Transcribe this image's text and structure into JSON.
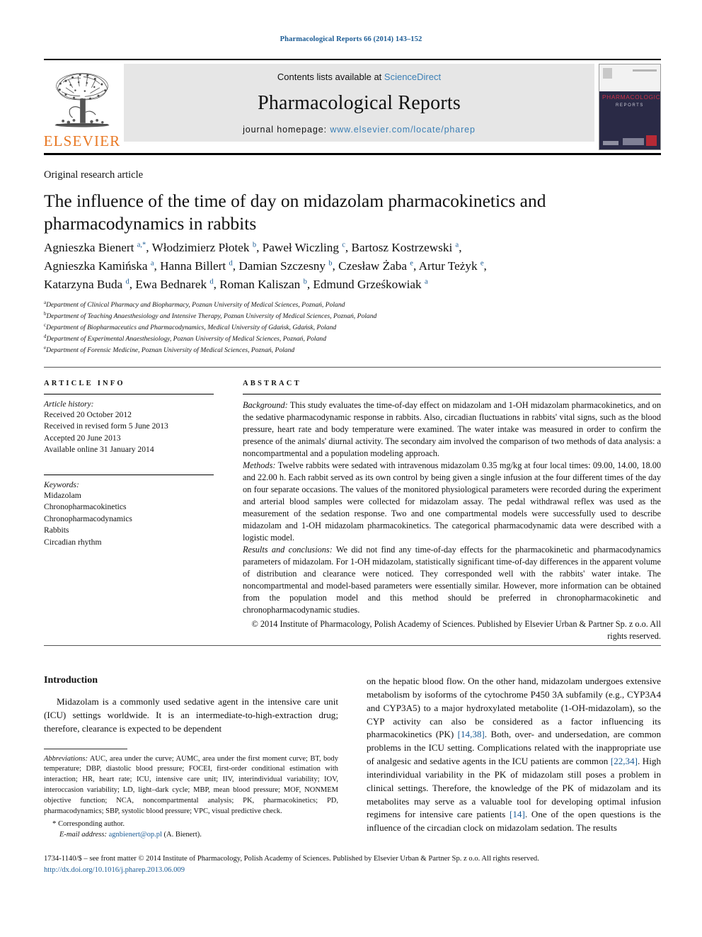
{
  "running_head": "Pharmacological Reports 66 (2014) 143–152",
  "masthead": {
    "contents_prefix": "Contents lists available at ",
    "sciencedirect": "ScienceDirect",
    "journal_name": "Pharmacological Reports",
    "homepage_prefix": "journal homepage: ",
    "homepage_url": "www.elsevier.com/locate/pharep",
    "publisher_logo_text": "ELSEVIER",
    "cover": {
      "title": "PHARMACOLOGICAL",
      "subtitle": "REPORTS"
    },
    "link_color": "#3b7fb5",
    "elsevier_orange": "#e87722"
  },
  "article": {
    "type": "Original research article",
    "title": "The influence of the time of day on midazolam pharmacokinetics and pharmacodynamics in rabbits",
    "authors_line1": "Agnieszka Bienert <sup>a,*</sup>, Włodzimierz Płotek <sup>b</sup>, Paweł Wiczling <sup>c</sup>, Bartosz Kostrzewski <sup>a</sup>,",
    "authors_line2": "Agnieszka Kamińska <sup>a</sup>, Hanna Billert <sup>d</sup>, Damian Szczesny <sup>b</sup>, Czesław Żaba <sup>e</sup>, Artur Teżyk <sup>e</sup>,",
    "authors_line3": "Katarzyna Buda <sup>d</sup>, Ewa Bednarek <sup>d</sup>, Roman Kaliszan <sup>b</sup>, Edmund Grześkowiak <sup>a</sup>",
    "affiliations": [
      {
        "mark": "a",
        "text": "Department of Clinical Pharmacy and Biopharmacy, Poznan University of Medical Sciences, Poznań, Poland"
      },
      {
        "mark": "b",
        "text": "Department of Teaching Anaesthesiology and Intensive Therapy, Poznan University of Medical Sciences, Poznań, Poland"
      },
      {
        "mark": "c",
        "text": "Department of Biopharmaceutics and Pharmacodynamics, Medical University of Gdańsk, Gdańsk, Poland"
      },
      {
        "mark": "d",
        "text": "Department of Experimental Anaesthesiology, Poznan University of Medical Sciences, Poznań, Poland"
      },
      {
        "mark": "e",
        "text": "Department of Forensic Medicine, Poznan University of Medical Sciences, Poznań, Poland"
      }
    ]
  },
  "article_info": {
    "label": "ARTICLE INFO",
    "history_heading": "Article history:",
    "history": [
      "Received 20 October 2012",
      "Received in revised form 5 June 2013",
      "Accepted 20 June 2013",
      "Available online 31 January 2014"
    ],
    "keywords_heading": "Keywords:",
    "keywords": [
      "Midazolam",
      "Chronopharmacokinetics",
      "Chronopharmacodynamics",
      "Rabbits",
      "Circadian rhythm"
    ]
  },
  "abstract": {
    "label": "ABSTRACT",
    "background_label": "Background:",
    "background_text": " This study evaluates the time-of-day effect on midazolam and 1-OH midazolam pharmacokinetics, and on the sedative pharmacodynamic response in rabbits. Also, circadian fluctuations in rabbits' vital signs, such as the blood pressure, heart rate and body temperature were examined. The water intake was measured in order to confirm the presence of the animals' diurnal activity. The secondary aim involved the comparison of two methods of data analysis: a noncompartmental and a population modeling approach.",
    "methods_label": "Methods:",
    "methods_text": " Twelve rabbits were sedated with intravenous midazolam 0.35 mg/kg at four local times: 09.00, 14.00, 18.00 and 22.00 h. Each rabbit served as its own control by being given a single infusion at the four different times of the day on four separate occasions. The values of the monitored physiological parameters were recorded during the experiment and arterial blood samples were collected for midazolam assay. The pedal withdrawal reflex was used as the measurement of the sedation response. Two and one compartmental models were successfully used to describe midazolam and 1-OH midazolam pharmacokinetics. The categorical pharmacodynamic data were described with a logistic model.",
    "results_label": "Results and conclusions:",
    "results_text": " We did not find any time-of-day effects for the pharmacokinetic and pharmacodynamics parameters of midazolam. For 1-OH midazolam, statistically significant time-of-day differences in the apparent volume of distribution and clearance were noticed. They corresponded well with the rabbits' water intake. The noncompartmental and model-based parameters were essentially similar. However, more information can be obtained from the population model and this method should be preferred in chronopharmacokinetic and chronopharmacodynamic studies.",
    "copyright": "© 2014 Institute of Pharmacology, Polish Academy of Sciences. Published by Elsevier Urban & Partner Sp. z o.o. All rights reserved."
  },
  "introduction": {
    "heading": "Introduction",
    "para1": "Midazolam is a commonly used sedative agent in the intensive care unit (ICU) settings worldwide. It is an intermediate-to-high-extraction drug; therefore, clearance is expected to be dependent",
    "right_col_part1": "on the hepatic blood flow. On the other hand, midazolam undergoes extensive metabolism by isoforms of the cytochrome P450 3A subfamily (e.g., CYP3A4 and CYP3A5) to a major hydroxylated metabolite (1-OH-midazolam), so the CYP activity can also be considered as a factor influencing its pharmacokinetics (PK) ",
    "ref1": "[14,38]",
    "right_col_part2": ". Both, over- and undersedation, are common problems in the ICU setting. Complications related with the inappropriate use of analgesic and sedative agents in the ICU patients are common ",
    "ref2": "[22,34]",
    "right_col_part3": ". High interindividual variability in the PK of midazolam still poses a problem in clinical settings. Therefore, the knowledge of the PK of midazolam and its metabolites may serve as a valuable tool for developing optimal infusion regimens for intensive care patients ",
    "ref3": "[14]",
    "right_col_part4": ". One of the open questions is the influence of the circadian clock on midazolam sedation. The results"
  },
  "footnotes": {
    "abbrev_label": "Abbreviations:",
    "abbrev_text": " AUC, area under the curve; AUMC, area under the first moment curve; BT, body temperature; DBP, diastolic blood pressure; FOCEI, first-order conditional estimation with interaction; HR, heart rate; ICU, intensive care unit; IIV, interindividual variability; IOV, interoccasion variability; LD, light–dark cycle; MBP, mean blood pressure; MOF, NONMEM objective function; NCA, noncompartmental analysis; PK, pharmacokinetics; PD, pharmacodynamics; SBP, systolic blood pressure; VPC, visual predictive check.",
    "corresponding": "Corresponding author.",
    "email_label": "E-mail address:",
    "email": "agnbienert@op.pl",
    "email_owner": "(A. Bienert)."
  },
  "footer": {
    "copyright_line": "1734-1140/$ – see front matter © 2014 Institute of Pharmacology, Polish Academy of Sciences. Published by Elsevier Urban & Partner Sp. z o.o. All rights reserved.",
    "doi": "http://dx.doi.org/10.1016/j.pharep.2013.06.009"
  }
}
